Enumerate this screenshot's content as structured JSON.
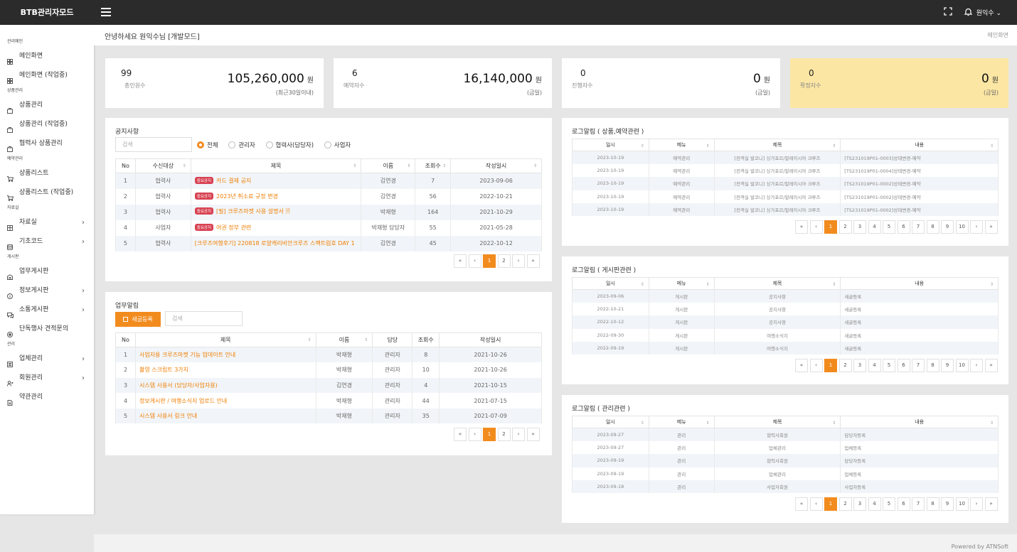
{
  "app": {
    "title": "BTB관리자모드",
    "user": "원익수"
  },
  "sidebar": {
    "sections": [
      {
        "title": "관리메인",
        "items": [
          {
            "label": "메인화면",
            "icon": "grid-icon"
          },
          {
            "label": "메인화면 (작업중)",
            "icon": "grid-icon"
          }
        ]
      },
      {
        "title": "상품관리",
        "items": [
          {
            "label": "상품관리",
            "icon": "briefcase-icon"
          },
          {
            "label": "상품관리 (작업중)",
            "icon": "briefcase-icon"
          },
          {
            "label": "협력사 상품관리",
            "icon": "briefcase-icon"
          }
        ]
      },
      {
        "title": "예약관리",
        "items": [
          {
            "label": "상품리스트",
            "icon": "cart-icon"
          },
          {
            "label": "상품리스트 (작업중)",
            "icon": "cart-icon"
          }
        ]
      },
      {
        "title": "자료실",
        "items": [
          {
            "label": "자료실",
            "icon": "table-icon",
            "arrow": true
          },
          {
            "label": "기초코드",
            "icon": "database-icon",
            "arrow": true
          }
        ]
      },
      {
        "title": "게시판",
        "items": [
          {
            "label": "업무게시판",
            "icon": "building-icon"
          },
          {
            "label": "정보게시판",
            "icon": "info-icon",
            "arrow": true
          },
          {
            "label": "소통게시판",
            "icon": "chat-icon",
            "arrow": true
          },
          {
            "label": "단독행사 견적문의",
            "icon": "target-icon"
          }
        ]
      },
      {
        "title": "관리",
        "items": [
          {
            "label": "업체관리",
            "icon": "list-icon",
            "arrow": true
          },
          {
            "label": "회원관리",
            "icon": "users-icon",
            "arrow": true
          },
          {
            "label": "약관관리",
            "icon": "doc-icon"
          }
        ]
      }
    ]
  },
  "header": {
    "greeting": "안녕하세요 원익수님 [개발모드]",
    "breadcrumb": "메인화면"
  },
  "stats": [
    {
      "count": "99",
      "count_label": "총인원수",
      "amount": "105,260,000",
      "unit": "원",
      "sub": "(최근30일이내)"
    },
    {
      "count": "6",
      "count_label": "예약자수",
      "amount": "16,140,000",
      "unit": "원",
      "sub": "(금일)"
    },
    {
      "count": "0",
      "count_label": "진행자수",
      "amount": "0",
      "unit": "원",
      "sub": "(금일)"
    },
    {
      "count": "0",
      "count_label": "확정자수",
      "amount": "0",
      "unit": "원",
      "sub": "(금일)"
    }
  ],
  "notice": {
    "title": "공지사항",
    "search_placeholder": "검색",
    "filters": [
      "전체",
      "관리자",
      "협력사(담당자)",
      "사업자"
    ],
    "columns": [
      "No",
      "수신대상",
      "제목",
      "이름",
      "조회수",
      "작성일시"
    ],
    "rows": [
      {
        "no": "1",
        "target": "협력사",
        "badge": "중요공지",
        "title": "카드 결제 공지",
        "name": "김연경",
        "views": "7",
        "date": "2023-09-06"
      },
      {
        "no": "2",
        "target": "협력사",
        "badge": "중요공지",
        "title": "2023년 취소료 규정 변경",
        "name": "김연경",
        "views": "56",
        "date": "2022-10-21"
      },
      {
        "no": "3",
        "target": "협력사",
        "badge": "중요공지",
        "title": "[필] 크루즈마켓 사용 설명서",
        "name": "박재형",
        "views": "164",
        "date": "2021-10-29"
      },
      {
        "no": "4",
        "target": "사업자",
        "badge": "중요공지",
        "title": "여권 정부 관련",
        "name": "박재형 담당자",
        "views": "55",
        "date": "2021-05-28"
      },
      {
        "no": "5",
        "target": "협력사",
        "badge": "",
        "title": "[크루즈여행후기] 220818 로얄캐리비안크루즈 스펙트럼호 DAY 1",
        "name": "김연경",
        "views": "45",
        "date": "2022-10-12"
      }
    ],
    "pages": [
      "«",
      "‹",
      "1",
      "2",
      "›",
      "»"
    ]
  },
  "work": {
    "title": "업무알림",
    "new_button": "새글등록",
    "search_placeholder": "검색",
    "columns": [
      "No",
      "제목",
      "이름",
      "담당",
      "조회수",
      "작성일시"
    ],
    "rows": [
      {
        "no": "1",
        "title": "사업자용 크루즈마켓 기능 업데이트 안내",
        "name": "박재형",
        "role": "관리자",
        "views": "8",
        "date": "2021-10-26"
      },
      {
        "no": "2",
        "title": "촬영 스크립트 3가지",
        "name": "박재형",
        "role": "관리자",
        "views": "10",
        "date": "2021-10-26"
      },
      {
        "no": "3",
        "title": "시스템 사용서 (담당자/사업자용)",
        "name": "김연경",
        "role": "관리자",
        "views": "4",
        "date": "2021-10-15"
      },
      {
        "no": "4",
        "title": "정보게시판 / 여행소식지 업로드 안내",
        "name": "박재형",
        "role": "관리자",
        "views": "44",
        "date": "2021-07-15"
      },
      {
        "no": "5",
        "title": "시스템 사용서 링크 안내",
        "name": "박재형",
        "role": "관리자",
        "views": "35",
        "date": "2021-07-09"
      }
    ],
    "pages": [
      "«",
      "‹",
      "1",
      "2",
      "›",
      "»"
    ]
  },
  "logs": [
    {
      "title": "로그알림 ( 상품,예약관련 )",
      "columns": [
        "일시",
        "메뉴",
        "제목",
        "내용"
      ],
      "rows": [
        {
          "date": "2023-10-19",
          "menu": "예약관리",
          "subject": "[전객실 발코니] 싱가포르/말레이시아 크루즈",
          "content": "[TS231019P01-0003]상태변경-예약"
        },
        {
          "date": "2023-10-19",
          "menu": "예약관리",
          "subject": "[전객실 발코니] 싱가포르/말레이시아 크루즈",
          "content": "[TS231019P01-0004]상태변경-예약"
        },
        {
          "date": "2023-10-19",
          "menu": "예약관리",
          "subject": "[전객실 발코니] 싱가포르/말레이시아 크루즈",
          "content": "[TS231019P01-0002]상태변경-예약"
        },
        {
          "date": "2023-10-19",
          "menu": "예약관리",
          "subject": "[전객실 발코니] 싱가포르/말레이시아 크루즈",
          "content": "[TS231019P01-0002]상태변경-예약"
        },
        {
          "date": "2023-10-19",
          "menu": "예약관리",
          "subject": "[전객실 발코니] 싱가포르/말레이시아 크루즈",
          "content": "[TS231019P01-0002]상태변경-예약"
        }
      ]
    },
    {
      "title": "로그알림 ( 게시판관련 )",
      "columns": [
        "일시",
        "메뉴",
        "제목",
        "내용"
      ],
      "rows": [
        {
          "date": "2023-09-06",
          "menu": "게시판",
          "subject": "공지사항",
          "content": "새글등록"
        },
        {
          "date": "2022-10-21",
          "menu": "게시판",
          "subject": "공지사항",
          "content": "새글등록"
        },
        {
          "date": "2022-10-12",
          "menu": "게시판",
          "subject": "공지사항",
          "content": "새글등록"
        },
        {
          "date": "2022-09-30",
          "menu": "게시판",
          "subject": "여행소식지",
          "content": "새글등록"
        },
        {
          "date": "2022-09-19",
          "menu": "게시판",
          "subject": "여행소식지",
          "content": "새글등록"
        }
      ]
    },
    {
      "title": "로그알림 ( 관리관련 )",
      "columns": [
        "일시",
        "메뉴",
        "제목",
        "내용"
      ],
      "rows": [
        {
          "date": "2023-09-27",
          "menu": "관리",
          "subject": "협력사회원",
          "content": "담당자등록"
        },
        {
          "date": "2023-09-27",
          "menu": "관리",
          "subject": "업체관리",
          "content": "업체등록"
        },
        {
          "date": "2023-09-19",
          "menu": "관리",
          "subject": "협력사회원",
          "content": "담당자등록"
        },
        {
          "date": "2023-09-19",
          "menu": "관리",
          "subject": "업체관리",
          "content": "업체등록"
        },
        {
          "date": "2023-09-18",
          "menu": "관리",
          "subject": "사업자회원",
          "content": "사업자등록"
        }
      ]
    }
  ],
  "log_pages": [
    "«",
    "‹",
    "1",
    "2",
    "3",
    "4",
    "5",
    "6",
    "7",
    "8",
    "9",
    "10",
    "›",
    "»"
  ],
  "footer": {
    "text": "Powered by ATNSoft"
  },
  "colors": {
    "accent": "#f28b1e",
    "badge": "#d84252",
    "topbar": "#2b2b2b",
    "highlight_card": "#fbe6a3"
  }
}
